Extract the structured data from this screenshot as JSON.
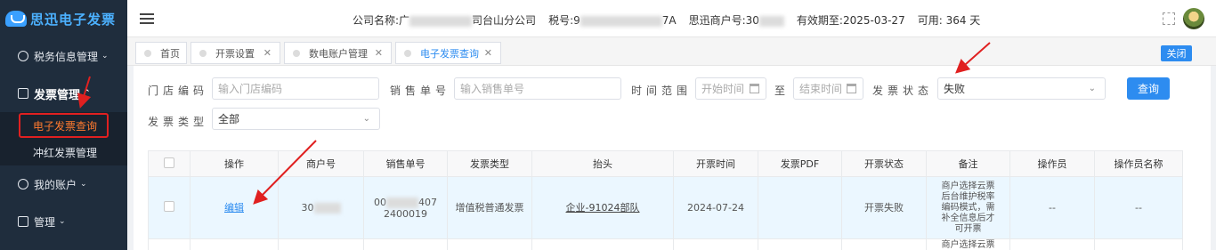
{
  "sidebar": {
    "logo_text": "思迅电子发票",
    "items": [
      {
        "label": "税务信息管理",
        "icon": "tax-icon"
      },
      {
        "label": "发票管理",
        "icon": "invoice-icon"
      },
      {
        "label": "我的账户",
        "icon": "account-icon"
      },
      {
        "label": "管理",
        "icon": "grid-icon"
      }
    ],
    "sub_items": [
      {
        "label": "电子发票查询"
      },
      {
        "label": "冲红发票管理"
      }
    ]
  },
  "header": {
    "company_label": "公司名称:广",
    "company_suffix": "司台山分公司",
    "tax_label": "税号:9",
    "tax_suffix": "7A",
    "merchant_label": "思迅商户号:30",
    "merchant_suffix": "",
    "expiry": "有效期至:2025-03-27",
    "available": "可用: 364 天"
  },
  "tabs": [
    {
      "label": "首页",
      "closable": false
    },
    {
      "label": "开票设置",
      "closable": true
    },
    {
      "label": "数电账户管理",
      "closable": true
    },
    {
      "label": "电子发票查询",
      "closable": true,
      "active": true
    }
  ],
  "close_all_label": "关闭",
  "filters": {
    "store_code_label": "门店编码",
    "store_code_placeholder": "输入门店编码",
    "sales_no_label": "销售单号",
    "sales_no_placeholder": "输入销售单号",
    "time_range_label": "时间范围",
    "start_placeholder": "开始时间",
    "to_label": "至",
    "end_placeholder": "结束时间",
    "status_label": "发票状态",
    "status_value": "失败",
    "type_label": "发票类型",
    "type_value": "全部",
    "query_label": "查询"
  },
  "table": {
    "columns": [
      "操作",
      "商户号",
      "销售单号",
      "发票类型",
      "抬头",
      "开票时间",
      "发票PDF",
      "开票状态",
      "备注",
      "操作员",
      "操作员名称"
    ],
    "rows": [
      {
        "action": "编辑",
        "merchant": "30",
        "sales_no_a": "00",
        "sales_no_b": "407",
        "sales_no_c": "2400019",
        "invoice_type": "增值税普通发票",
        "title": "企业-91024部队",
        "issue_time": "2024-07-24",
        "pdf": "",
        "status": "开票失败",
        "remark": "商户选择云票后台维护税率编码模式，需补全信息后才可开票",
        "operator": "--",
        "operator_name": "--"
      }
    ],
    "next_row_remark": "商户选择云票"
  },
  "colors": {
    "sidebar_bg": "#1f2d3d",
    "accent": "#2d8cf0",
    "highlight_orange": "#ff7a2f",
    "annotation_red": "#e02020"
  }
}
